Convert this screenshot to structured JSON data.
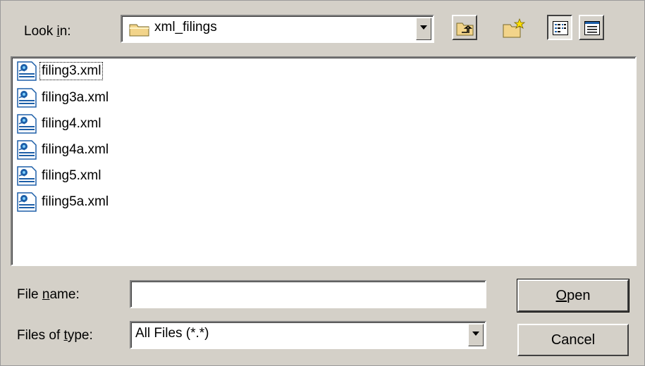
{
  "look_in": {
    "label_pre": "Look ",
    "label_hot": "i",
    "label_post": "n:",
    "value": "xml_filings"
  },
  "files": [
    {
      "name": "filing3.xml"
    },
    {
      "name": "filing3a.xml"
    },
    {
      "name": "filing4.xml"
    },
    {
      "name": "filing4a.xml"
    },
    {
      "name": "filing5.xml"
    },
    {
      "name": "filing5a.xml"
    }
  ],
  "file_name": {
    "label_pre": "File ",
    "label_hot": "n",
    "label_post": "ame:",
    "value": ""
  },
  "file_type": {
    "label_pre": "Files of ",
    "label_hot": "t",
    "label_post": "ype:",
    "value": "All Files (*.*)"
  },
  "buttons": {
    "open_hot": "O",
    "open_rest": "pen",
    "cancel": "Cancel"
  },
  "colors": {
    "face": "#d4d0c8",
    "folder": "#f2d48a",
    "xml_icon": "#1d5fa8"
  }
}
